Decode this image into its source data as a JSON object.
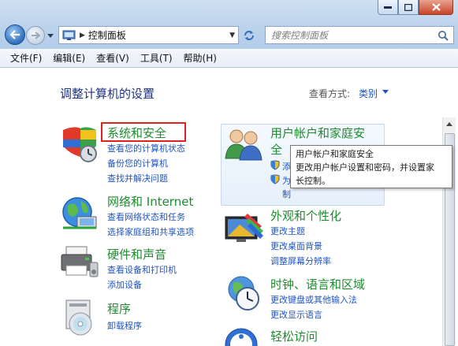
{
  "window": {
    "minimize_label": "minimize",
    "maximize_label": "maximize",
    "close_label": "close"
  },
  "address": {
    "location": "控制面板"
  },
  "search": {
    "placeholder": "搜索控制面板"
  },
  "menu": [
    "文件(F)",
    "编辑(E)",
    "查看(V)",
    "工具(T)",
    "帮助(H)"
  ],
  "header": {
    "title": "调整计算机的设置",
    "view_by_label": "查看方式:",
    "view_by_value": "类别"
  },
  "categories": {
    "security": {
      "title": "系统和安全",
      "links": [
        "查看您的计算机状态",
        "备份您的计算机",
        "查找并解决问题"
      ]
    },
    "network": {
      "title": "网络和 Internet",
      "links": [
        "查看网络状态和任务",
        "选择家庭组和共享选项"
      ]
    },
    "hardware": {
      "title": "硬件和声音",
      "links": [
        "查看设备和打印机",
        "添加设备"
      ]
    },
    "programs": {
      "title": "程序",
      "links": [
        "卸载程序"
      ]
    },
    "users": {
      "title_line1": "用户帐户和家庭安",
      "title_line2": "全",
      "links_partial": [
        "添",
        "为",
        "制"
      ]
    },
    "appearance": {
      "title": "外观和个性化",
      "links": [
        "更改主题",
        "更改桌面背景",
        "调整屏幕分辨率"
      ]
    },
    "clock": {
      "title": "时钟、语言和区域",
      "links": [
        "更改键盘或其他输入法",
        "更改显示语言"
      ]
    },
    "ease": {
      "title": "轻松访问"
    }
  },
  "tooltip": {
    "title": "用户帐户和家庭安全",
    "desc_line1": "更改用户帐户设置和密码，并设置家",
    "desc_line2": "长控制。"
  },
  "colors": {
    "category_title": "#1e8c2e",
    "link": "#1f55c4",
    "page_title": "#1e3287",
    "highlight": "#e12020"
  }
}
